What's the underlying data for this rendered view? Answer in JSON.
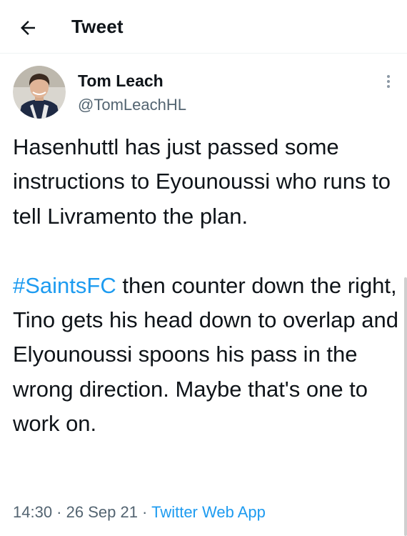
{
  "header": {
    "title": "Tweet",
    "back_icon": "arrow-left-icon"
  },
  "author": {
    "name": "Tom Leach",
    "handle": "@TomLeachHL",
    "avatar_icon": "user-avatar",
    "more_icon": "more-vertical-icon"
  },
  "tweet": {
    "text_part1": "Hasenhuttl has just passed some instructions to Eyounoussi who runs to tell Livramento the plan.\n\n",
    "hashtag": "#SaintsFC",
    "text_part2": " then counter down the right, Tino gets his head down to overlap and Elyounoussi spoons his pass in the wrong direction. Maybe that's one to work on."
  },
  "meta": {
    "time": "14:30",
    "separator": " · ",
    "date": "26 Sep 21",
    "source": "Twitter Web App"
  },
  "colors": {
    "accent": "#1d9bf0",
    "muted": "#536471",
    "text": "#0f1419",
    "divider": "#eff3f4"
  }
}
